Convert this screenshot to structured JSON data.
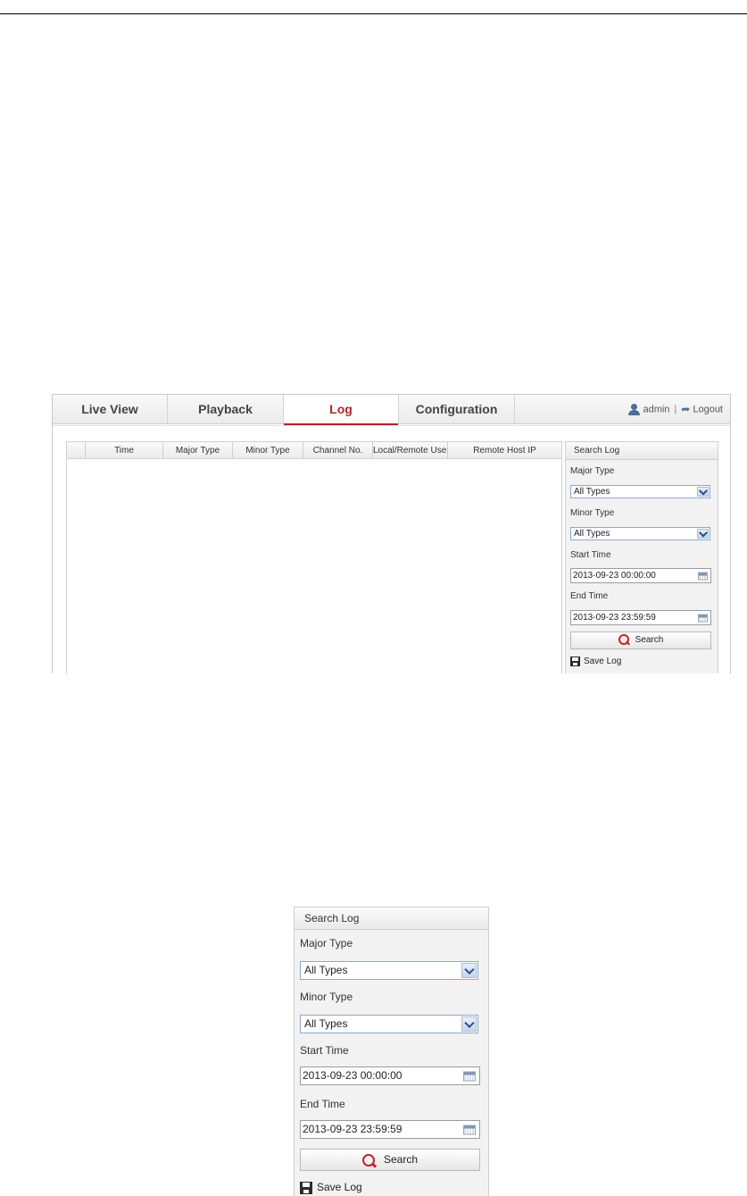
{
  "nav": {
    "tabs": [
      {
        "label": "Live View"
      },
      {
        "label": "Playback"
      },
      {
        "label": "Log"
      },
      {
        "label": "Configuration"
      }
    ],
    "active_tab": "Log",
    "user": "admin",
    "separator": "|",
    "logout": "Logout"
  },
  "log_table": {
    "columns": [
      "",
      "Time",
      "Major Type",
      "Minor Type",
      "Channel No.",
      "Local/Remote User",
      "Remote Host IP"
    ],
    "rows": []
  },
  "search_panel": {
    "title": "Search Log",
    "major_type_label": "Major Type",
    "major_type_value": "All Types",
    "minor_type_label": "Minor Type",
    "minor_type_value": "All Types",
    "start_time_label": "Start Time",
    "start_time_value": "2013-09-23 00:00:00",
    "end_time_label": "End Time",
    "end_time_value": "2013-09-23 23:59:59",
    "search_button": "Search",
    "save_log": "Save Log"
  },
  "colors": {
    "active_tab": "#b3222b",
    "search_icon": "#c0242b",
    "select_border": "#8fa8c8",
    "panel_bg": "#f2f2f2"
  },
  "icons": {
    "user": "user-icon",
    "logout": "logout-icon",
    "dropdown": "chevron-down-icon",
    "calendar": "calendar-icon",
    "search": "magnifier-icon",
    "save": "floppy-disk-icon"
  }
}
